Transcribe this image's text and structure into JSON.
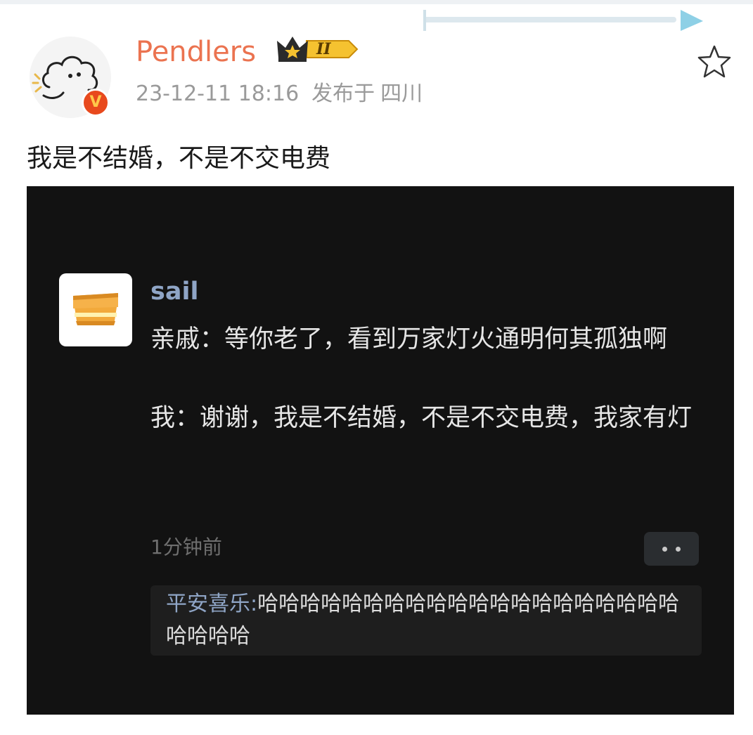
{
  "post": {
    "username": "Pendlers",
    "vip_level": "II",
    "verified_mark": "V",
    "timestamp": "23-12-11 18:16",
    "location_prefix": "发布于",
    "location": "四川",
    "text": "我是不结婚，不是不交电费"
  },
  "embedded": {
    "author": "sail",
    "message_line1": "亲戚：等你老了，看到万家灯火通明何其孤独啊",
    "message_line2": "我：谢谢，我是不结婚，不是不交电费，我家有灯",
    "time": "1分钟前",
    "reply": {
      "author": "平安喜乐",
      "separator": ":",
      "text": "哈哈哈哈哈哈哈哈哈哈哈哈哈哈哈哈哈哈哈哈哈哈哈哈"
    }
  },
  "icons": {
    "star": "star-outline-icon",
    "crown": "crown-icon",
    "more": "more-dots-icon",
    "toast_avatar": "toast-sandwich-icon"
  },
  "colors": {
    "username": "#eb7350",
    "meta": "#9a9a9a",
    "embedded_bg": "#121212",
    "embedded_name": "#8fa5c6",
    "verified_badge": "#e8491d"
  }
}
